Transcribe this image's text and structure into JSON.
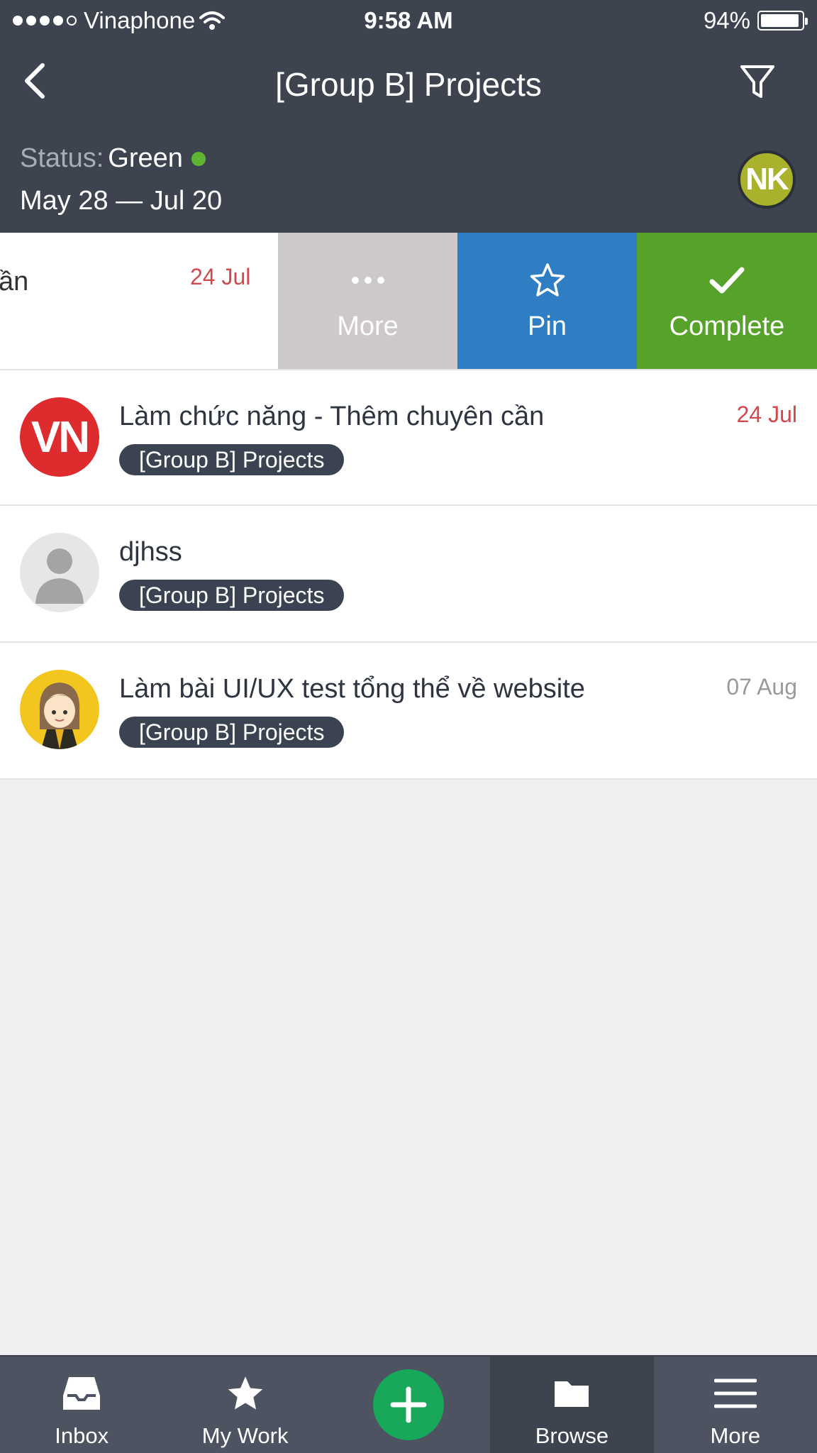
{
  "status_bar": {
    "carrier": "Vinaphone",
    "time": "9:58 AM",
    "battery": "94%",
    "battery_level": 0.94
  },
  "header": {
    "title": "[Group B] Projects",
    "status_label": "Status:",
    "status_value": "Green",
    "status_color": "#5fb531",
    "date_range": "May 28 — Jul 20",
    "avatar_initials": "NK"
  },
  "swiped_row": {
    "title_fragment": "ần",
    "date": "24 Jul",
    "actions": {
      "more": "More",
      "pin": "Pin",
      "complete": "Complete"
    }
  },
  "tasks": [
    {
      "title": "Làm chức năng - Thêm chuyên cần",
      "tag": "[Group B] Projects",
      "date": "24 Jul",
      "avatar_text": "VN"
    },
    {
      "title": "djhss",
      "tag": "[Group B] Projects",
      "date": "",
      "avatar_text": ""
    },
    {
      "title": "Làm bài UI/UX test tổng thể về website",
      "tag": "[Group B] Projects",
      "date": "07 Aug",
      "avatar_text": ""
    }
  ],
  "tabbar": {
    "inbox": "Inbox",
    "my_work": "My Work",
    "browse": "Browse",
    "more": "More",
    "active": "Browse"
  }
}
